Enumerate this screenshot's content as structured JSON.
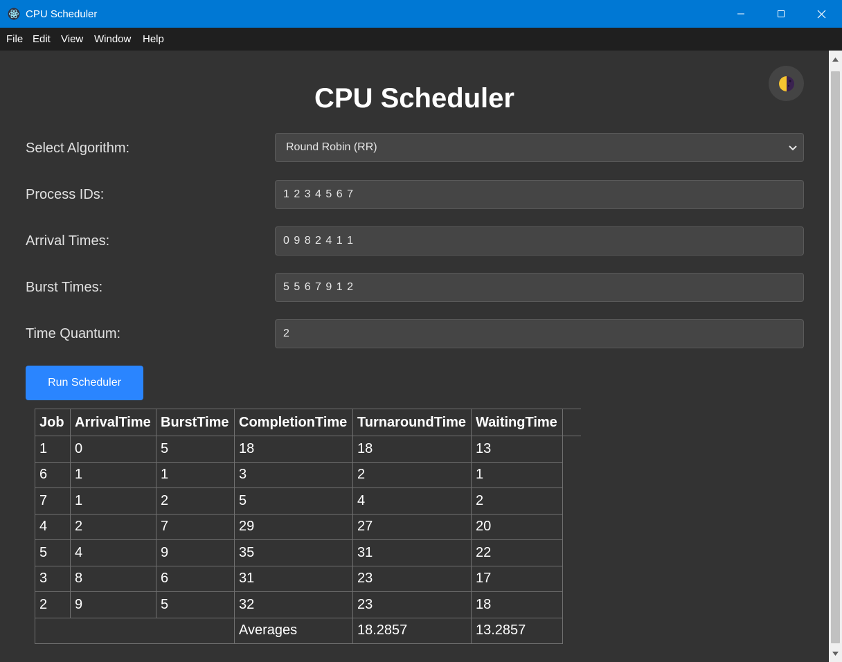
{
  "window": {
    "title": "CPU Scheduler"
  },
  "menu": [
    "File",
    "Edit",
    "View",
    "Window",
    "Help"
  ],
  "page": {
    "title": "CPU Scheduler"
  },
  "form": {
    "algorithm": {
      "label": "Select Algorithm:",
      "value": "Round Robin (RR)"
    },
    "process_ids": {
      "label": "Process IDs:",
      "value": "1 2 3 4 5 6 7"
    },
    "arrival_times": {
      "label": "Arrival Times:",
      "value": "0 9 8 2 4 1 1"
    },
    "burst_times": {
      "label": "Burst Times:",
      "value": "5 5 6 7 9 1 2"
    },
    "time_quantum": {
      "label": "Time Quantum:",
      "value": "2"
    },
    "run_label": "Run Scheduler"
  },
  "table": {
    "headers": [
      "Job",
      "ArrivalTime",
      "BurstTime",
      "CompletionTime",
      "TurnaroundTime",
      "WaitingTime"
    ],
    "rows": [
      [
        "1",
        "0",
        "5",
        "18",
        "18",
        "13"
      ],
      [
        "6",
        "1",
        "1",
        "3",
        "2",
        "1"
      ],
      [
        "7",
        "1",
        "2",
        "5",
        "4",
        "2"
      ],
      [
        "4",
        "2",
        "7",
        "29",
        "27",
        "20"
      ],
      [
        "5",
        "4",
        "9",
        "35",
        "31",
        "22"
      ],
      [
        "3",
        "8",
        "6",
        "31",
        "23",
        "17"
      ],
      [
        "2",
        "9",
        "5",
        "32",
        "23",
        "18"
      ]
    ],
    "averages": {
      "label": "Averages",
      "turnaround": "18.2857",
      "waiting": "13.2857"
    }
  },
  "colors": {
    "titlebar": "#0078d4",
    "menubar": "#1f1f1f",
    "background": "#333333",
    "accent": "#2a85ff"
  },
  "icons": {
    "app": "electron-icon",
    "theme": "half-moon-icon"
  }
}
